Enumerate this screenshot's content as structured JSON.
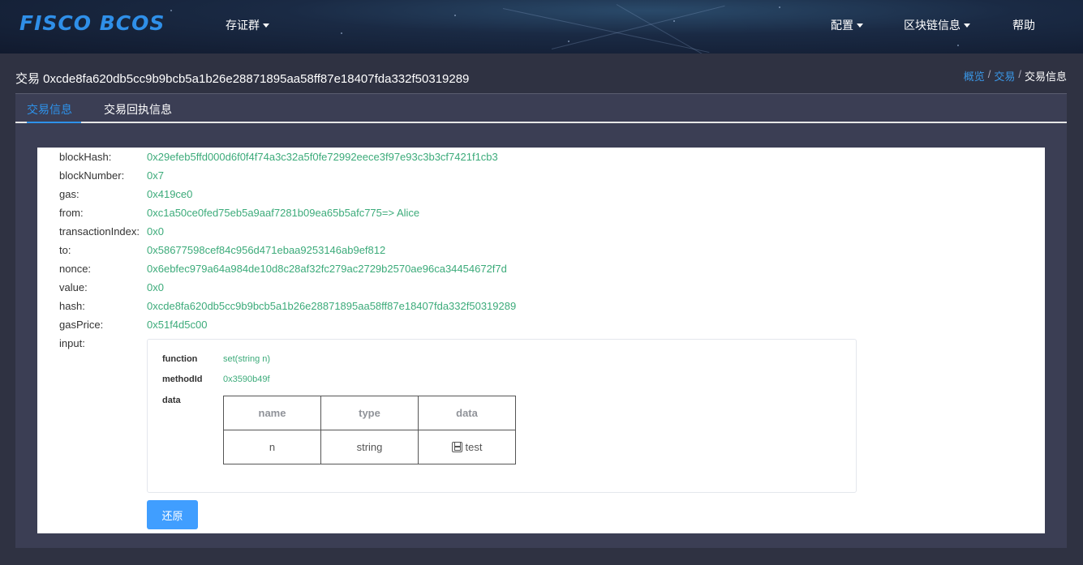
{
  "header": {
    "logo": "FISCO BCOS",
    "nav_left": [
      {
        "label": "存证群"
      }
    ],
    "nav_right": [
      {
        "label": "配置"
      },
      {
        "label": "区块链信息"
      },
      {
        "label": "帮助"
      }
    ]
  },
  "page": {
    "title": "交易 0xcde8fa620db5cc9b9bcb5a1b26e28871895aa58ff87e18407fda332f50319289",
    "breadcrumb": [
      "概览",
      "交易",
      "交易信息"
    ]
  },
  "tabs": [
    {
      "label": "交易信息",
      "active": true
    },
    {
      "label": "交易回执信息",
      "active": false
    }
  ],
  "fields": [
    {
      "label": "blockHash:",
      "value": "0x29efeb5ffd000d6f0f4f74a3c32a5f0fe72992eece3f97e93c3b3cf7421f1cb3"
    },
    {
      "label": "blockNumber:",
      "value": "0x7"
    },
    {
      "label": "gas:",
      "value": "0x419ce0"
    },
    {
      "label": "from:",
      "value": "0xc1a50ce0fed75eb5a9aaf7281b09ea65b5afc775=> Alice"
    },
    {
      "label": "transactionIndex:",
      "value": "0x0"
    },
    {
      "label": "to:",
      "value": "0x58677598cef84c956d471ebaa9253146ab9ef812"
    },
    {
      "label": "nonce:",
      "value": "0x6ebfec979a64a984de10d8c28af32fc279ac2729b2570ae96ca34454672f7d"
    },
    {
      "label": "value:",
      "value": "0x0"
    },
    {
      "label": "hash:",
      "value": "0xcde8fa620db5cc9b9bcb5a1b26e28871895aa58ff87e18407fda332f50319289"
    },
    {
      "label": "gasPrice:",
      "value": "0x51f4d5c00"
    }
  ],
  "input": {
    "label": "input:",
    "function_label": "function",
    "function_value": "set(string n)",
    "methodid_label": "methodId",
    "methodid_value": "0x3590b49f",
    "data_label": "data",
    "table": {
      "headers": [
        "name",
        "type",
        "data"
      ],
      "rows": [
        [
          "n",
          "string",
          "test"
        ]
      ]
    }
  },
  "restore_button": "还原",
  "colors": {
    "accent": "#409eff",
    "value_green": "#3cab7a",
    "panel": "#3b3e54"
  },
  "icons": {
    "data_cell": "save-icon",
    "nav_dropdown": "caret-down-icon"
  }
}
